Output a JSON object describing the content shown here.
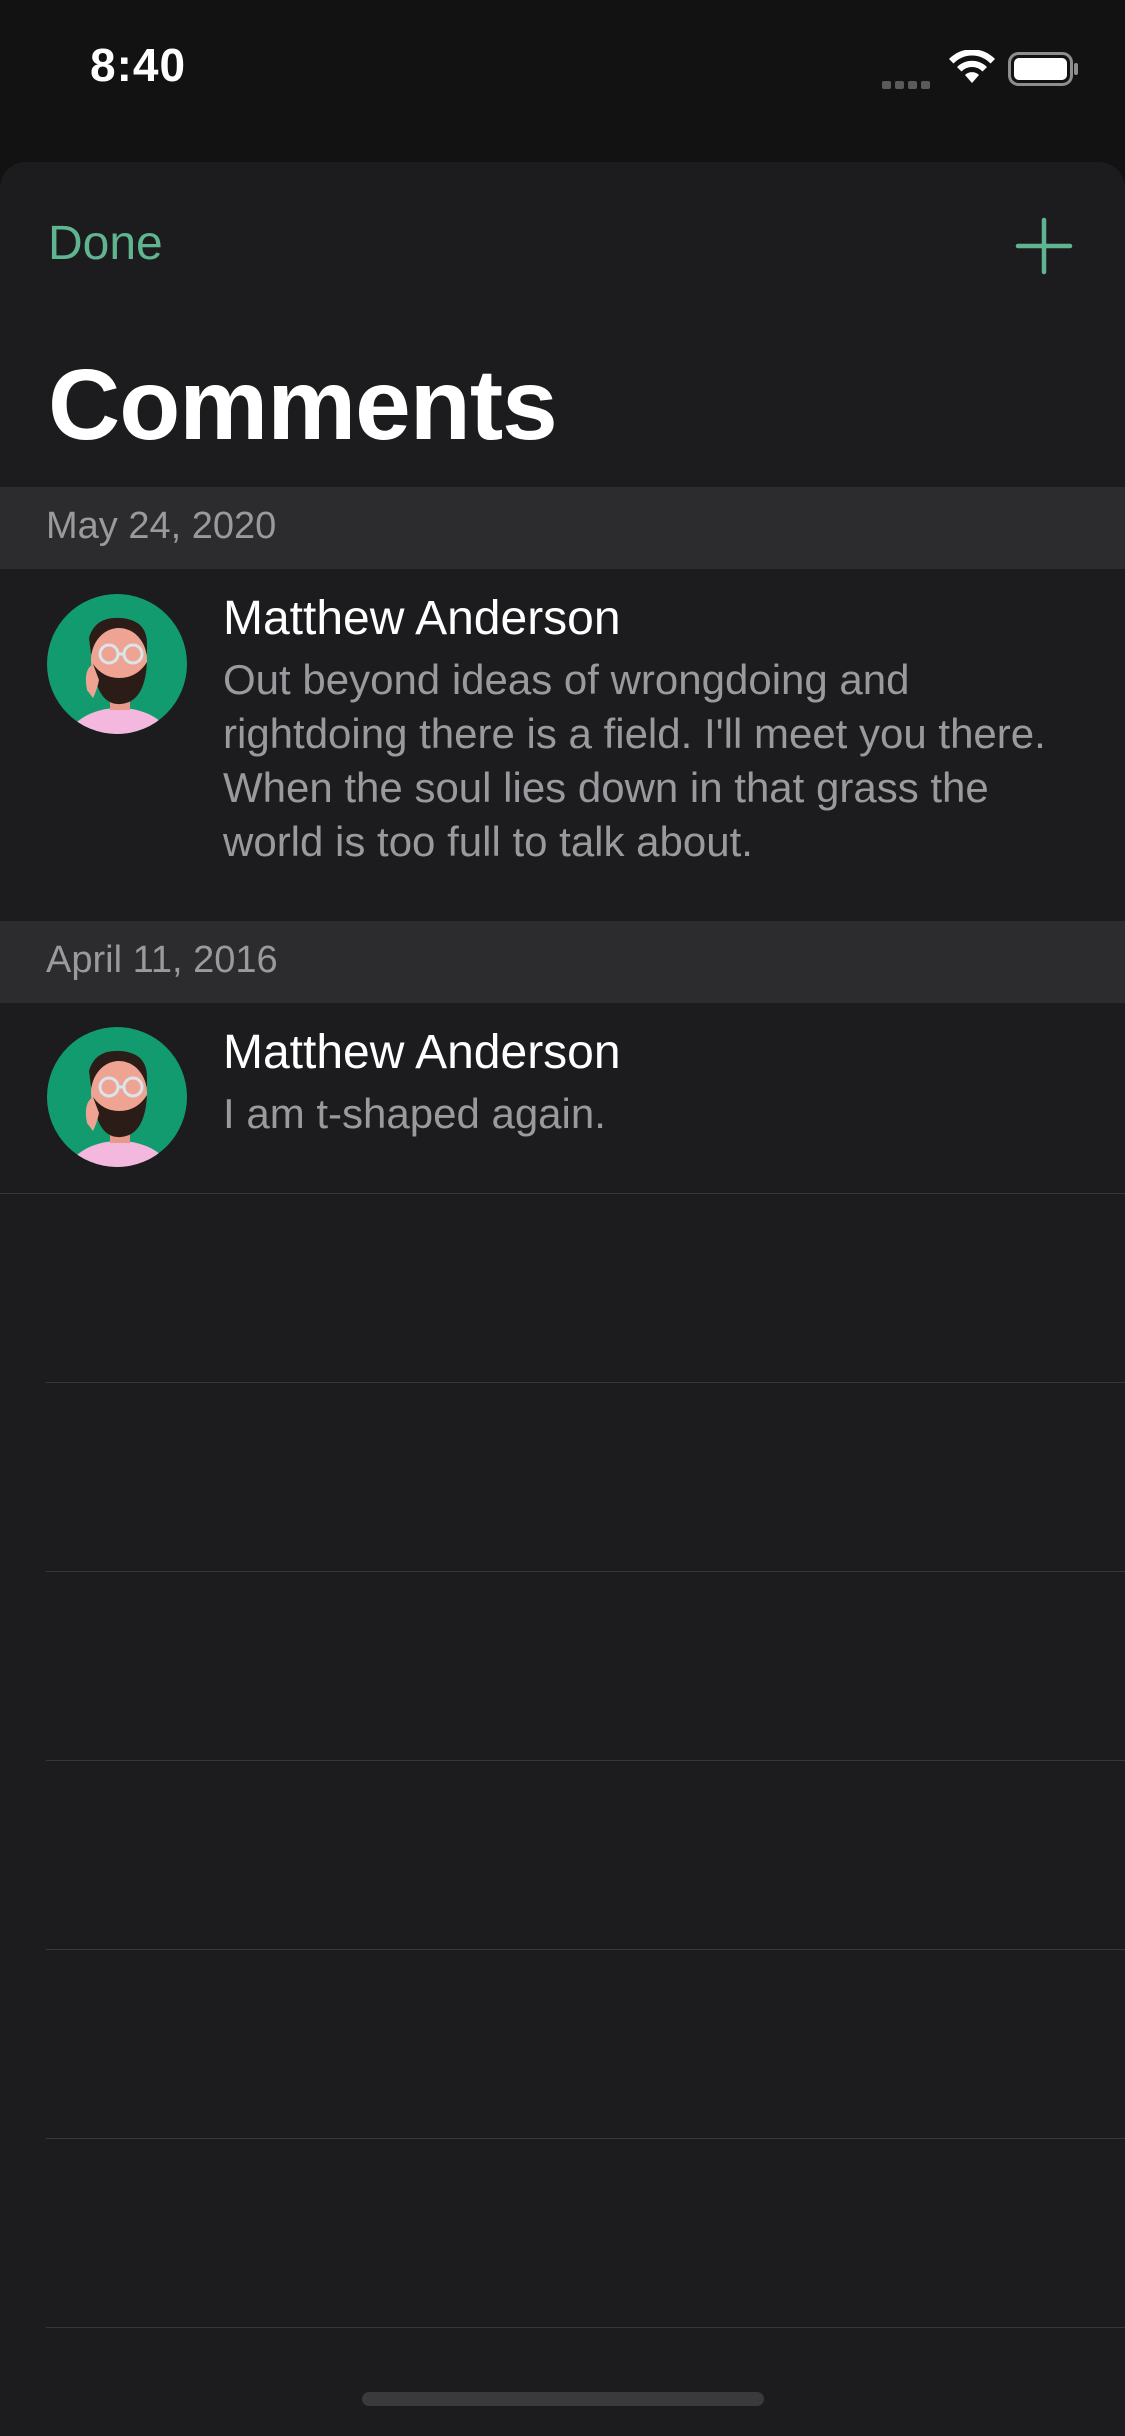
{
  "status_bar": {
    "time": "8:40"
  },
  "nav": {
    "done_label": "Done",
    "add_icon": "plus-icon",
    "title": "Comments"
  },
  "colors": {
    "accent": "#5fb58f",
    "background": "#1c1c1e",
    "section_header": "#2c2c2e",
    "secondary_text": "#9a9a9e",
    "primary_text": "#ffffff"
  },
  "sections": [
    {
      "date": "May 24, 2020",
      "comments": [
        {
          "author": "Matthew Anderson",
          "text": "Out beyond ideas of wrongdoing and rightdoing there is a field. I'll meet you there. When the soul lies down in that grass the world is too full to talk about.",
          "avatar_icon": "avatar-icon"
        }
      ]
    },
    {
      "date": "April 11, 2016",
      "comments": [
        {
          "author": "Matthew Anderson",
          "text": "I am t-shaped again.",
          "avatar_icon": "avatar-icon"
        }
      ]
    }
  ]
}
